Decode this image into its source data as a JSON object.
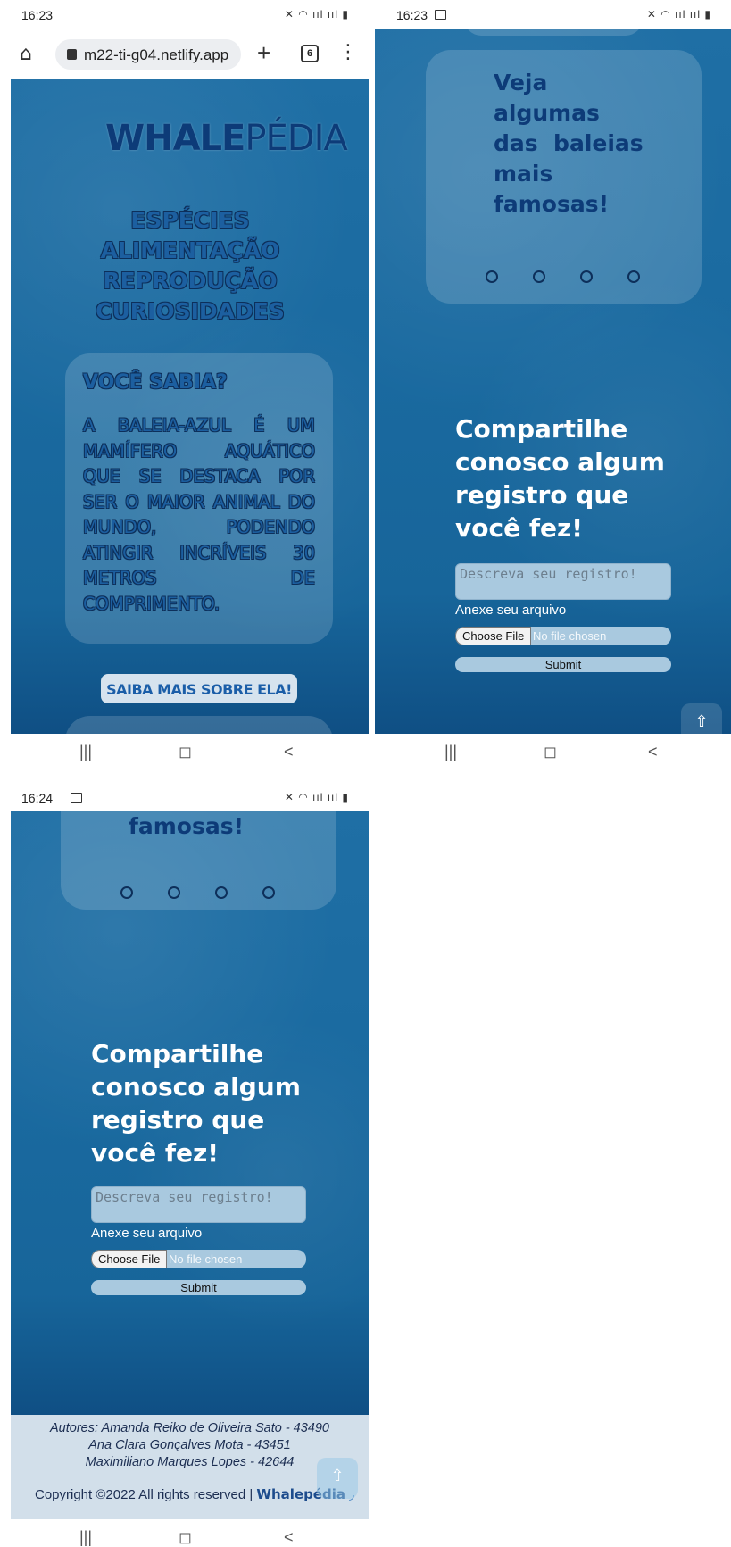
{
  "screens": [
    {
      "status": {
        "time": "16:23",
        "show_picture_icon": false
      }
    },
    {
      "status": {
        "time": "16:23",
        "show_picture_icon": true
      }
    },
    {
      "status": {
        "time": "16:24",
        "show_picture_icon": true
      }
    }
  ],
  "status_icons": "✕ ◠ ııl ııl ▮",
  "browser": {
    "url": "m22-ti-g04.netlify.app",
    "tab_count": "6"
  },
  "nav": {
    "recent": "|||",
    "home": "◻",
    "back": "<"
  },
  "site": {
    "logo_bold": "WHALE",
    "logo_thin": "PÉDIA",
    "menu": [
      "ESPÉCIES",
      "ALIMENTAÇÃO",
      "REPRODUÇÃO",
      "CURIOSIDADES"
    ],
    "did_you_know": {
      "title": "VOCÊ SABIA?",
      "text": "A BALEIA-AZUL É UM MAMÍFERO AQUÁTICO QUE SE DESTACA POR SER O MAIOR ANIMAL DO MUNDO, PODENDO ATINGIR INCRÍVEIS 30 METROS DE COMPRIMENTO."
    },
    "saiba_mais": "SAIBA MAIS SOBRE ELA!",
    "famous": {
      "lines": [
        "Veja",
        "algumas",
        "das  baleias",
        "mais",
        "famosas!"
      ],
      "last_line": "famosas!"
    },
    "share": {
      "title_lines": [
        "Compartilhe",
        "conosco algum",
        "registro que",
        "você fez!"
      ],
      "textarea_placeholder": "Descreva seu registro!",
      "attach_label": "Anexe seu arquivo",
      "choose_file": "Choose File",
      "no_file": "No file chosen",
      "submit": "Submit"
    },
    "back_to_top": "⇧",
    "footer": {
      "authors": [
        "Autores: Amanda Reiko de Oliveira Sato - 43490",
        "Ana Clara Gonçalves Mota - 43451",
        "Maximiliano Marques Lopes - 42644"
      ],
      "copyright": "Copyright ©2022 All rights reserved |",
      "brand": "Whalepédia"
    }
  }
}
